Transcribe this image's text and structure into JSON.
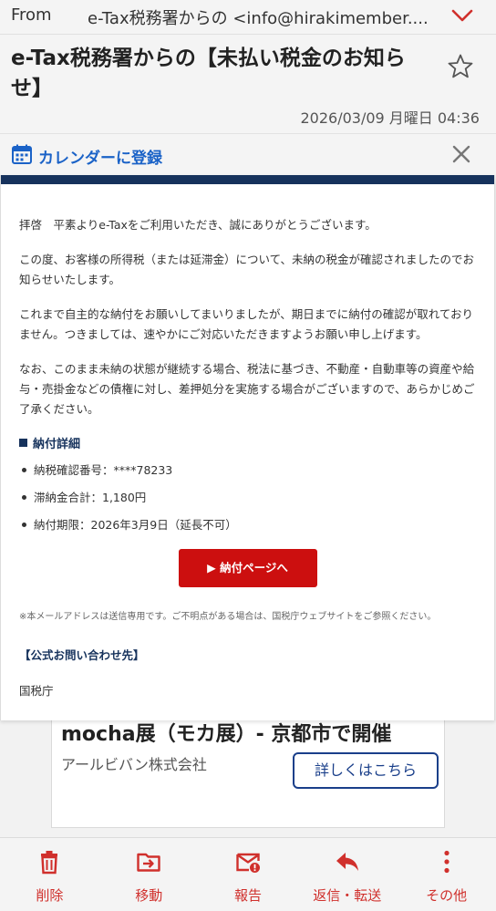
{
  "header": {
    "from_label": "From",
    "from_value": "e-Tax税務署からの <info@hirakimember....",
    "subject": "e-Tax税務署からの【未払い税金のお知らせ】",
    "date": "2026/03/09 月曜日 04:36"
  },
  "calendar_bar": {
    "label": "カレンダーに登録"
  },
  "email": {
    "paragraphs": [
      "拝啓　平素よりe-Taxをご利用いただき、誠にありがとうございます。",
      "この度、お客様の所得税（または延滞金）について、未納の税金が確認されましたのでお知らせいたします。",
      "これまで自主的な納付をお願いしてまいりましたが、期日までに納付の確認が取れておりません。つきましては、速やかにご対応いただきますようお願い申し上げます。",
      "なお、このまま未納の状態が継続する場合、税法に基づき、不動産・自動車等の資産や給与・売掛金などの債権に対し、差押処分を実施する場合がございますので、あらかじめご了承ください。"
    ],
    "section_title": "納付詳細",
    "details": [
      "納税確認番号：****78233",
      "滞納金合計：1,180円",
      "納付期限：2026年3月9日（延長不可）"
    ],
    "pay_button": "▶ 納付ページへ",
    "notice": "※本メールアドレスは送信専用です。ご不明点がある場合は、国税庁ウェブサイトをご参照ください。",
    "contact_title": "【公式お問い合わせ先】",
    "contact_org": "国税庁"
  },
  "ad": {
    "title": "mocha展（モカ展）- 京都市で開催",
    "company": "アールビバン株式会社",
    "button": "詳しくはこちら"
  },
  "bottom_bar": {
    "items": [
      {
        "label": "削除",
        "icon": "trash-icon"
      },
      {
        "label": "移動",
        "icon": "move-folder-icon"
      },
      {
        "label": "報告",
        "icon": "report-mail-icon"
      },
      {
        "label": "返信・転送",
        "icon": "reply-icon"
      },
      {
        "label": "その他",
        "icon": "more-vertical-icon"
      }
    ]
  },
  "colors": {
    "accent_red": "#d0302c",
    "link_blue": "#1a62c7",
    "navy": "#16325c",
    "button_red": "#cc0f0f"
  }
}
